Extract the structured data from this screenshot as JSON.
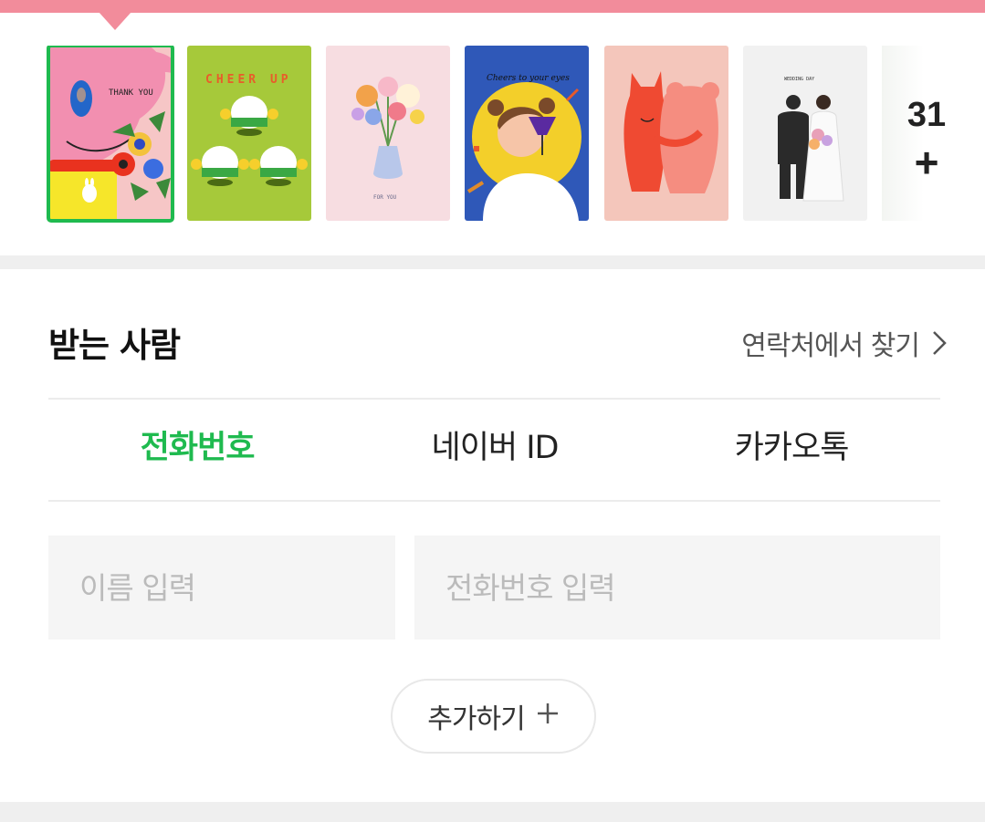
{
  "recipient": {
    "title": "받는 사람",
    "contacts_link": "연락처에서 찾기",
    "tabs": [
      {
        "label": "전화번호",
        "active": true
      },
      {
        "label": "네이버 ID",
        "active": false
      },
      {
        "label": "카카오톡",
        "active": false
      }
    ],
    "name_placeholder": "이름 입력",
    "phone_placeholder": "전화번호 입력",
    "add_label": "추가하기"
  },
  "cards": {
    "more_count": "31",
    "more_plus": "+",
    "texts": {
      "thank_you": "THANK YOU",
      "cheer_up": "CHEER UP",
      "for_you": "FOR YOU",
      "cheers": "Cheers to your eyes",
      "wedding_day": "WEDDING DAY"
    }
  },
  "colors": {
    "accent": "#1fba4f",
    "top_bar": "#f28c9b"
  }
}
